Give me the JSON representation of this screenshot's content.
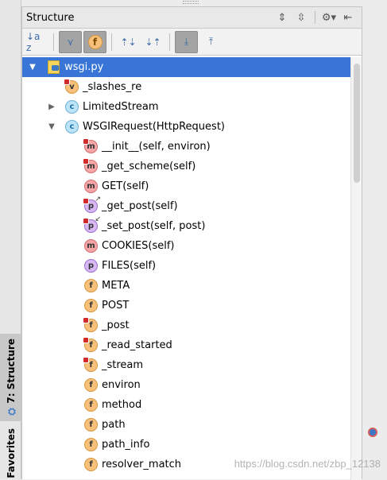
{
  "panel": {
    "title": "Structure"
  },
  "title_actions": [
    {
      "name": "expand-all-icon",
      "glyph": "⇕"
    },
    {
      "name": "collapse-all-icon",
      "glyph": "⇳"
    },
    {
      "name": "gear-icon",
      "glyph": "⚙▾"
    },
    {
      "name": "hide-panel-icon",
      "glyph": "⇤"
    }
  ],
  "toolbar": [
    {
      "name": "sort-alpha-button",
      "glyph": "↓a z",
      "on": false
    },
    {
      "name": "show-inherited-button",
      "glyph": "⋎",
      "on": true
    },
    {
      "name": "show-fields-button",
      "glyph": "f",
      "on": true
    },
    {
      "name": "expand-button",
      "glyph": "⇡⇣",
      "on": false
    },
    {
      "name": "collapse-button",
      "glyph": "⇣⇡",
      "on": false
    },
    {
      "name": "autoscroll-to-source-button",
      "glyph": "⤓",
      "on": true
    },
    {
      "name": "autoscroll-from-source-button",
      "glyph": "⤒",
      "on": false
    }
  ],
  "tree": [
    {
      "label": "wsgi.py",
      "kind": "file",
      "depth": 0,
      "toggle": "▼",
      "selected": true
    },
    {
      "label": "_slashes_re",
      "kind": "v",
      "depth": 1,
      "toggle": "",
      "lock": true
    },
    {
      "label": "LimitedStream",
      "kind": "c",
      "depth": 1,
      "toggle": "▶"
    },
    {
      "label": "WSGIRequest(HttpRequest)",
      "kind": "c",
      "depth": 1,
      "toggle": "▼"
    },
    {
      "label": "__init__(self, environ)",
      "kind": "m",
      "depth": 2,
      "lock": true
    },
    {
      "label": "_get_scheme(self)",
      "kind": "m",
      "depth": 2,
      "lock": true
    },
    {
      "label": "GET(self)",
      "kind": "m",
      "depth": 2
    },
    {
      "label": "_get_post(self)",
      "kind": "p",
      "depth": 2,
      "lock": true,
      "badge": "↗"
    },
    {
      "label": "_set_post(self, post)",
      "kind": "p",
      "depth": 2,
      "lock": true,
      "badge": "↙"
    },
    {
      "label": "COOKIES(self)",
      "kind": "m",
      "depth": 2
    },
    {
      "label": "FILES(self)",
      "kind": "p",
      "depth": 2
    },
    {
      "label": "META",
      "kind": "f",
      "depth": 2
    },
    {
      "label": "POST",
      "kind": "f",
      "depth": 2
    },
    {
      "label": "_post",
      "kind": "f",
      "depth": 2,
      "lock": true
    },
    {
      "label": "_read_started",
      "kind": "f",
      "depth": 2,
      "lock": true
    },
    {
      "label": "_stream",
      "kind": "f",
      "depth": 2,
      "lock": true
    },
    {
      "label": "environ",
      "kind": "f",
      "depth": 2
    },
    {
      "label": "method",
      "kind": "f",
      "depth": 2
    },
    {
      "label": "path",
      "kind": "f",
      "depth": 2
    },
    {
      "label": "path_info",
      "kind": "f",
      "depth": 2
    },
    {
      "label": "resolver_match",
      "kind": "f",
      "depth": 2
    }
  ],
  "side_tabs": {
    "structure": "7: Structure",
    "favorites": "Favorites"
  },
  "watermark": "https://blog.csdn.net/zbp_12138"
}
